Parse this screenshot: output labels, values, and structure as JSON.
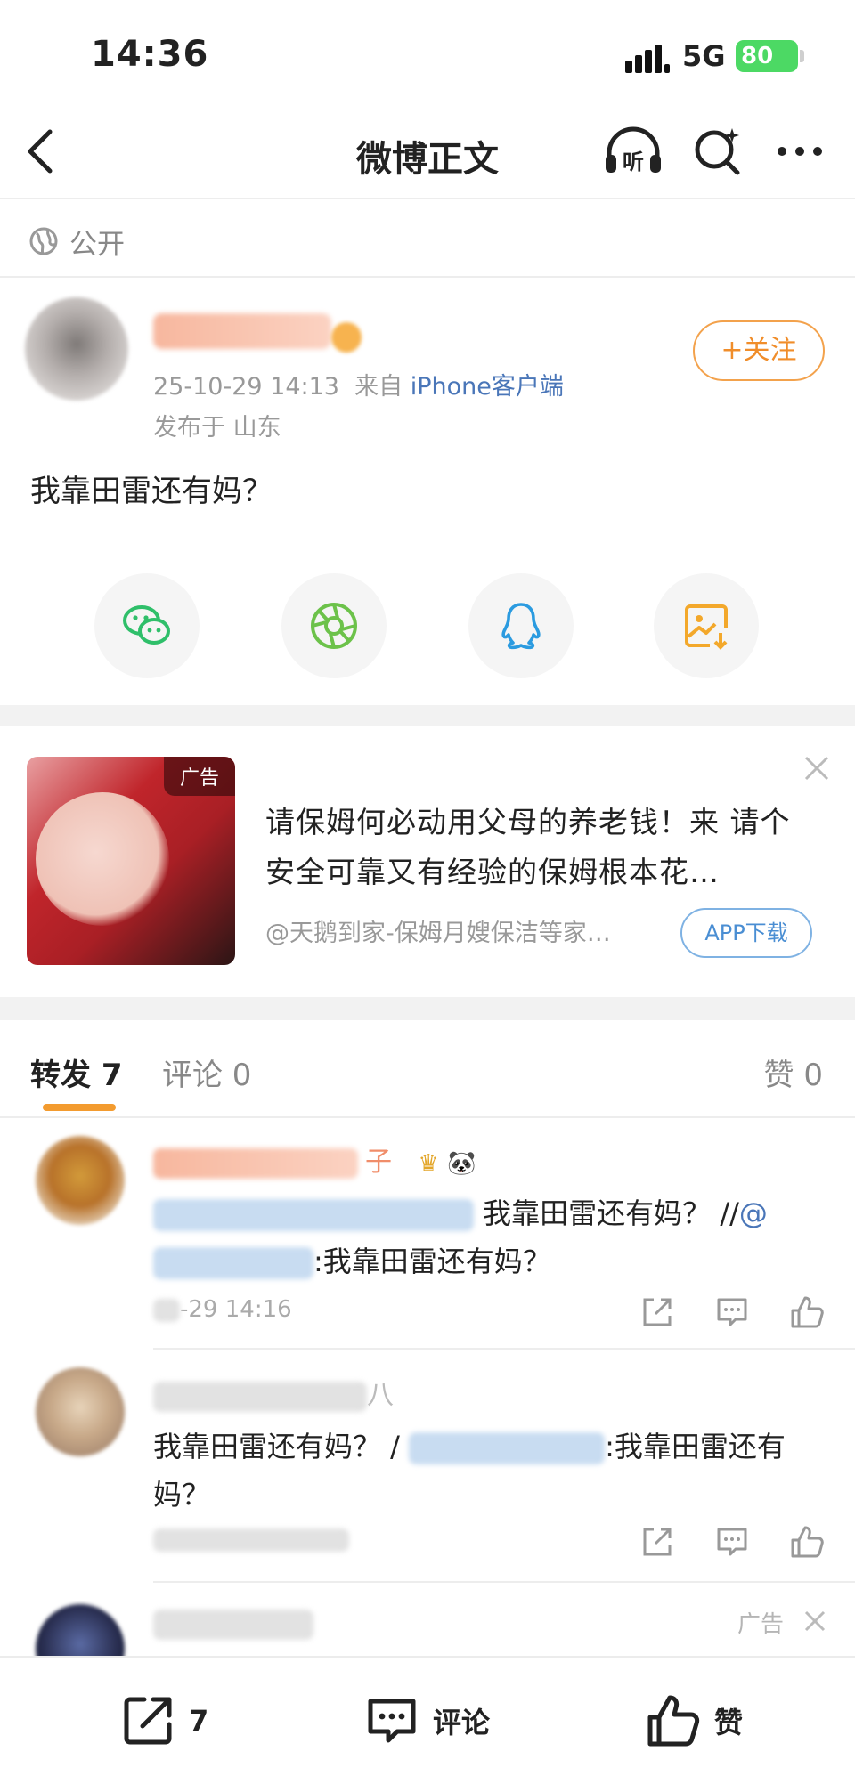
{
  "status_bar": {
    "time": "14:36",
    "network": "5G",
    "battery": "80"
  },
  "nav": {
    "title": "微博正文",
    "icons": [
      "back-icon",
      "listen-icon",
      "smart-search-icon",
      "more-icon"
    ]
  },
  "visibility": {
    "label": "公开"
  },
  "post": {
    "date": "25-10-29 14:13",
    "from_prefix": "来自",
    "source": "iPhone客户端",
    "location": "发布于 山东",
    "follow_label": "+关注",
    "text": "我靠田雷还有妈？",
    "share_targets": [
      "wechat-icon",
      "moments-icon",
      "qq-icon",
      "save-image-icon"
    ]
  },
  "ad": {
    "tag": "广告",
    "text": "请保姆何必动用父母的养老钱！来 请个安全可靠又有经验的保姆根本花…",
    "source": "@天鹅到家-保姆月嫂保洁等家…",
    "download_label": "APP下载"
  },
  "tabs": {
    "repost": "转发 7",
    "comment": "评论 0",
    "like": "赞 0"
  },
  "reposts": [
    {
      "name_tail": "子",
      "badge": "🐼",
      "text_a": "我靠田雷还有妈？ //",
      "at": "@",
      "text_b": ":我靠田雷还有妈？",
      "time": "-29 14:16"
    },
    {
      "name_tail": "八",
      "text_a": "我靠田雷还有妈？ /",
      "text_b": ":我靠田雷还有妈？"
    },
    {
      "ad_label": "广告"
    }
  ],
  "bottom_bar": {
    "repost_count": "7",
    "comment_label": "评论",
    "like_label": "赞"
  },
  "colors": {
    "accent": "#f39b2f",
    "link": "#4a76b8",
    "follow": "#f08d2a"
  }
}
